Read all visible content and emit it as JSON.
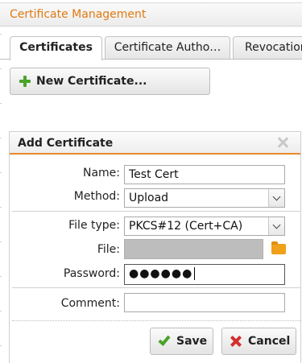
{
  "window": {
    "title": "Certificate Management"
  },
  "tabs": [
    {
      "label": "Certificates",
      "active": true
    },
    {
      "label": "Certificate Autho…",
      "active": false
    },
    {
      "label": "Revocation",
      "active": false
    }
  ],
  "toolbar": {
    "new_certificate_label": "New Certificate..."
  },
  "dialog": {
    "title": "Add Certificate",
    "labels": {
      "name": "Name:",
      "method": "Method:",
      "file_type": "File type:",
      "file": "File:",
      "password": "Password:",
      "comment": "Comment:"
    },
    "values": {
      "name": "Test Cert",
      "method": "Upload",
      "file_type": "PKCS#12 (Cert+CA)",
      "file": "",
      "password_masked": "●●●●●●",
      "comment": ""
    },
    "buttons": {
      "save": "Save",
      "cancel": "Cancel"
    }
  },
  "colors": {
    "accent_orange": "#e07a10",
    "dialog_underline": "#e8892b",
    "plus_green": "#4aa329",
    "cancel_red": "#d32f2f",
    "folder_orange": "#f0a019"
  },
  "icons": {
    "new_certificate": "plus-icon",
    "close": "close-icon",
    "select_arrow": "chevron-down-icon",
    "browse": "folder-icon",
    "save": "check-icon",
    "cancel": "x-icon"
  }
}
